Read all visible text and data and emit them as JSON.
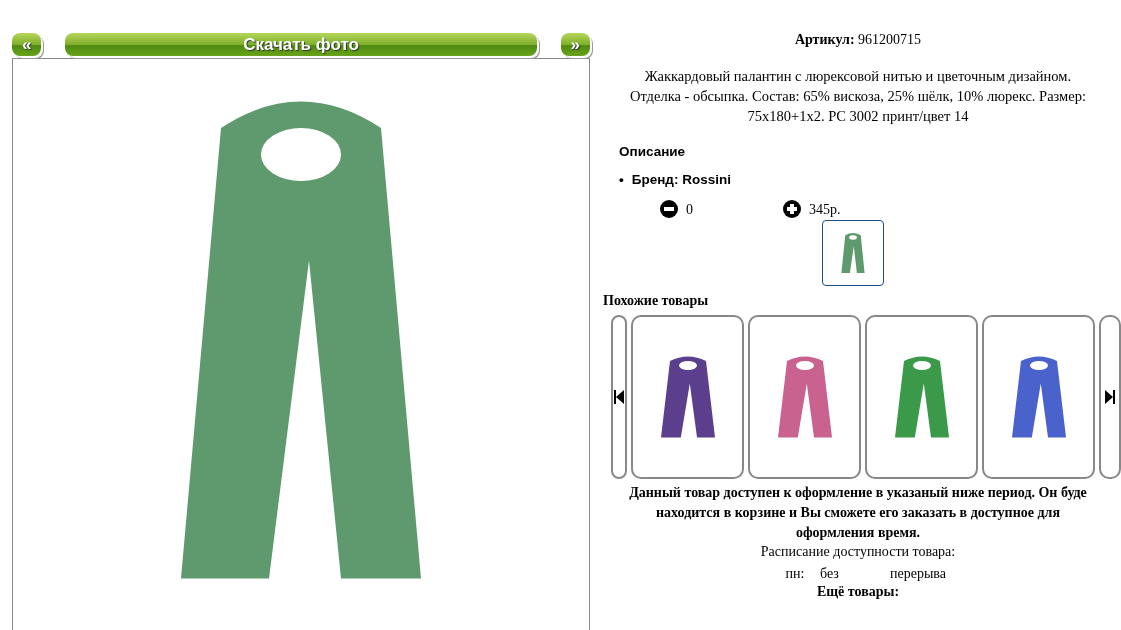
{
  "photo_nav": {
    "prev": "«",
    "download": "Скачать фото",
    "next": "»"
  },
  "main_photo": {
    "color": "#5f9a6e"
  },
  "product": {
    "sku_label": "Артикул:",
    "sku": "961200715",
    "description": "Жаккардовый палантин с люрексовой нитью и цветочным дизайном. Отделка - обсыпка. Состав: 65% вискоза, 25% шёлк, 10% люрекс. Размер: 75x180+1x2. PC 3002 принт/цвет 14",
    "section_title": "Описание",
    "attributes": [
      {
        "bullet": "•",
        "text": "Бренд: Rossini"
      }
    ],
    "quantity": "0",
    "price": "345р.",
    "thumbnails": [
      {
        "color": "#5f9a6e",
        "selected": true
      }
    ]
  },
  "similar": {
    "title": "Похожие товары",
    "items": [
      {
        "color": "#5b3f8c"
      },
      {
        "color": "#c9628e"
      },
      {
        "color": "#3a9a4a"
      },
      {
        "color": "#4a62cc"
      }
    ]
  },
  "notice": [
    "Данный товар доступен к оформление в указаный ниже период. Он буде",
    "находится в корзине и Вы сможете его заказать в доступное для оформления время."
  ],
  "schedule": {
    "title": "Расписание доступности товара:",
    "rows": [
      {
        "day": "пн:",
        "from": "без",
        "to": "перерыва"
      }
    ]
  },
  "more_title": "Ещё товары:"
}
